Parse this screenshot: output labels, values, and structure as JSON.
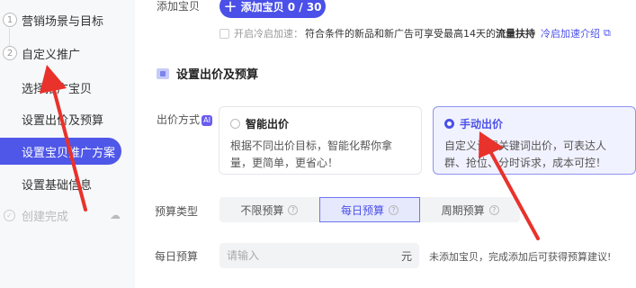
{
  "sidebar": {
    "step1": {
      "num": "1",
      "label": "营销场景与目标"
    },
    "step2": {
      "num": "2",
      "label": "自定义推广"
    },
    "sub_items": [
      "选择推广宝贝",
      "设置出价及预算",
      "设置宝贝推广方案",
      "设置基础信息"
    ],
    "done_label": "创建完成",
    "done_icon": "check-circle-icon",
    "cloud_icon": "cloud-icon"
  },
  "add_item": {
    "label": "添加宝贝",
    "button": "添加宝贝 0 / 30"
  },
  "cold_start": {
    "label": "开启冷启加速：",
    "text": "符合条件的新品和新广告可享受最高14天的",
    "bold": "流量扶持",
    "link": "冷启加速介绍"
  },
  "section": {
    "title": "设置出价及预算"
  },
  "bid": {
    "label": "出价方式",
    "ai": "AI",
    "options": [
      {
        "title": "智能出价",
        "desc": "根据不同出价目标，智能化帮你拿量，更简单，更省心！",
        "selected": false
      },
      {
        "title": "手动出价",
        "desc": "自定义设置关键词出价，可表达人群、抢位、分时诉求，成本可控！",
        "selected": true
      }
    ]
  },
  "budget_type": {
    "label": "预算类型",
    "options": [
      "不限预算",
      "每日预算",
      "周期预算"
    ],
    "selected": "每日预算"
  },
  "daily_budget": {
    "label": "每日预算",
    "placeholder": "请输入",
    "unit": "元",
    "hint": "未添加宝贝，完成添加后可获得预算建议!"
  },
  "colors": {
    "primary": "#4a50e8",
    "arrow": "#e8322b"
  }
}
